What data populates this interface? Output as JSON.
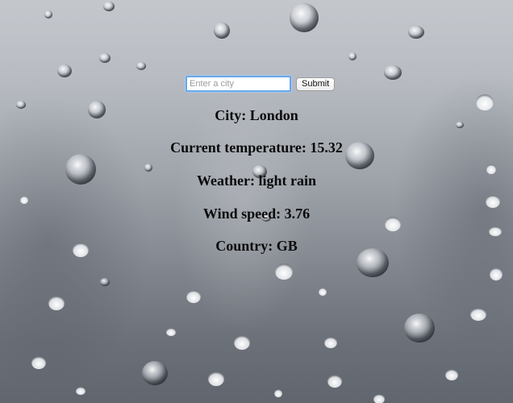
{
  "search": {
    "placeholder": "Enter a city",
    "value": "",
    "submit_label": "Submit"
  },
  "weather": {
    "city": "City: London",
    "temperature": "Current temperature: 15.32",
    "description": "Weather: light rain",
    "wind": "Wind speed: 3.76",
    "country": "Country: GB"
  }
}
